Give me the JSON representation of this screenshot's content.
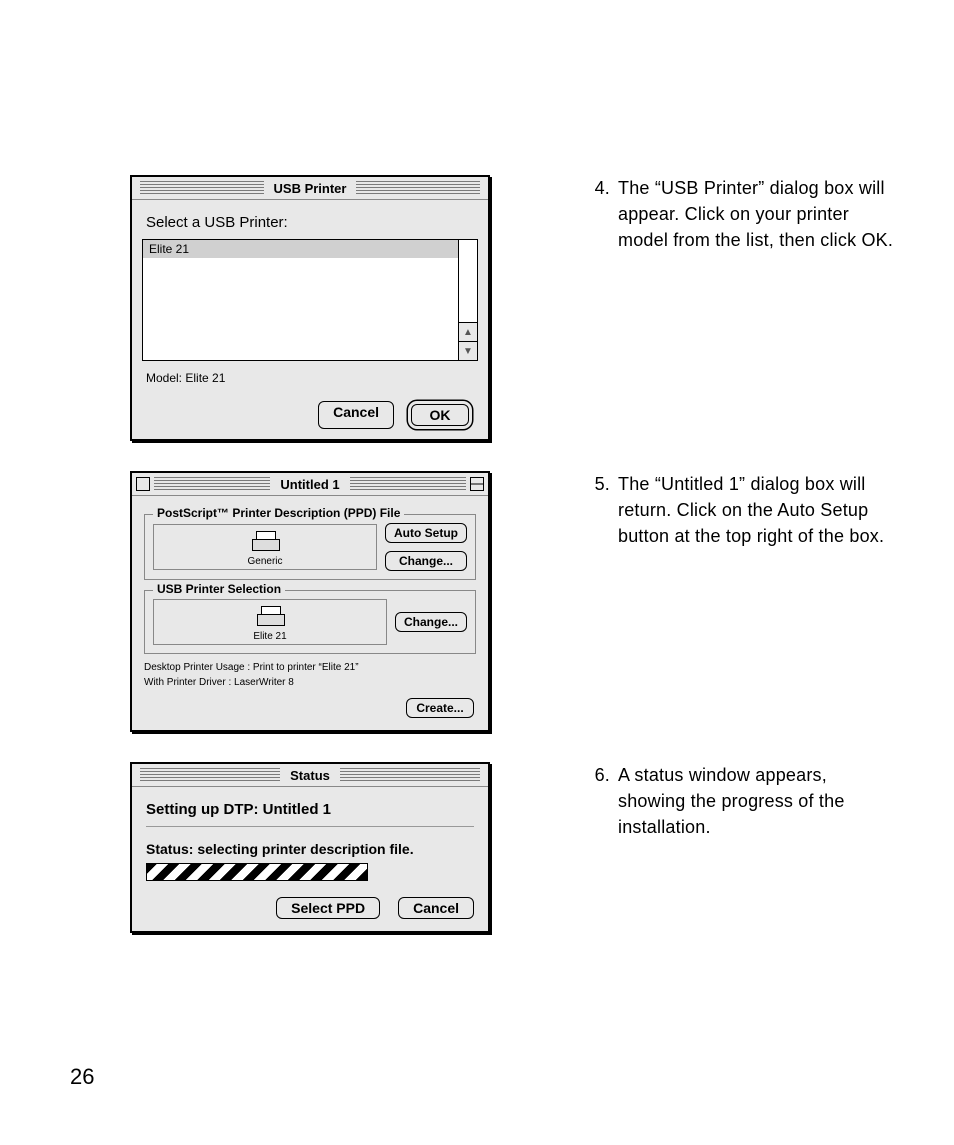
{
  "page_number": "26",
  "steps": [
    {
      "num": "4.",
      "text": "The “USB Printer” dialog box will appear. Click on your printer model from the list, then click OK."
    },
    {
      "num": "5.",
      "text": "The “Untitled 1” dialog box will return. Click on the Auto Setup button at the top right of the box."
    },
    {
      "num": "6.",
      "text": "A status window appears, showing the progress of the installation."
    }
  ],
  "usb_dialog": {
    "title": "USB Printer",
    "prompt": "Select a USB Printer:",
    "list_item": "Elite 21",
    "model_line": "Model: Elite 21",
    "cancel": "Cancel",
    "ok": "OK"
  },
  "untitled_dialog": {
    "title": "Untitled 1",
    "group1_label": "PostScript™ Printer Description (PPD) File",
    "group1_caption": "Generic",
    "auto_setup": "Auto Setup",
    "change": "Change...",
    "group2_label": "USB Printer Selection",
    "group2_caption": "Elite 21",
    "change2": "Change...",
    "note1": "Desktop Printer Usage : Print to printer “Elite 21”",
    "note2": "With Printer Driver : LaserWriter 8",
    "create": "Create..."
  },
  "status_dialog": {
    "title": "Status",
    "heading": "Setting up DTP: Untitled 1",
    "status_line": "Status: selecting printer description file.",
    "select_ppd": "Select PPD",
    "cancel": "Cancel"
  }
}
